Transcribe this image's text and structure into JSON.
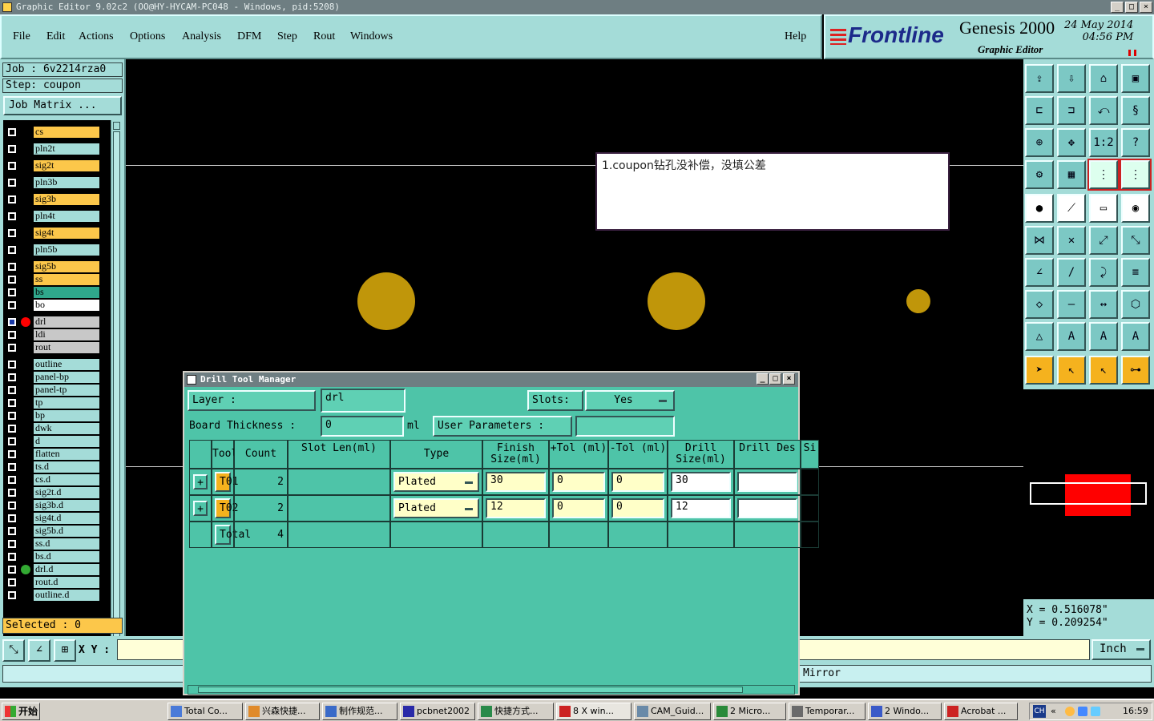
{
  "window": {
    "title": "Graphic Editor 9.02c2 (OO@HY-HYCAM-PC048 - Windows, pid:5208)"
  },
  "menu": [
    "File",
    "Edit",
    "Actions",
    "Options",
    "Analysis",
    "DFM",
    "Step",
    "Rout",
    "Windows"
  ],
  "help_label": "Help",
  "brand": {
    "logo": "Frontline",
    "product": "Genesis 2000",
    "subtitle": "Graphic Editor",
    "date": "24 May 2014",
    "time": "04:56 PM"
  },
  "left_panel": {
    "job": "Job : 6v2214rza0",
    "step": "Step: coupon",
    "job_matrix": "Job Matrix ...",
    "layers": [
      {
        "name": "cs",
        "color": "#fcc74a"
      },
      {
        "name": "pln2t",
        "color": "#a4dcd8"
      },
      {
        "name": "sig2t",
        "color": "#fcc74a"
      },
      {
        "name": "pln3b",
        "color": "#a4dcd8"
      },
      {
        "name": "sig3b",
        "color": "#fcc74a"
      },
      {
        "name": "pln4t",
        "color": "#a4dcd8"
      },
      {
        "name": "sig4t",
        "color": "#fcc74a"
      },
      {
        "name": "pln5b",
        "color": "#a4dcd8"
      },
      {
        "name": "sig5b",
        "color": "#fcc74a"
      },
      {
        "name": "ss",
        "color": "#fcc74a"
      },
      {
        "name": "bs",
        "color": "#2fa88c"
      },
      {
        "name": "bo",
        "color": "#ffffff"
      },
      {
        "name": "drl",
        "color": "#c8c8c8"
      },
      {
        "name": "ldi",
        "color": "#c8c8c8"
      },
      {
        "name": "rout",
        "color": "#c8c8c8"
      },
      {
        "name": "outline",
        "color": "#a4dcd8"
      },
      {
        "name": "panel-bp",
        "color": "#a4dcd8"
      },
      {
        "name": "panel-tp",
        "color": "#a4dcd8"
      },
      {
        "name": "tp",
        "color": "#a4dcd8"
      },
      {
        "name": "bp",
        "color": "#a4dcd8"
      },
      {
        "name": "dwk",
        "color": "#a4dcd8"
      },
      {
        "name": "d",
        "color": "#a4dcd8"
      },
      {
        "name": "flatten",
        "color": "#a4dcd8"
      },
      {
        "name": "ts.d",
        "color": "#a4dcd8"
      },
      {
        "name": "cs.d",
        "color": "#a4dcd8"
      },
      {
        "name": "sig2t.d",
        "color": "#a4dcd8"
      },
      {
        "name": "sig3b.d",
        "color": "#a4dcd8"
      },
      {
        "name": "sig4t.d",
        "color": "#a4dcd8"
      },
      {
        "name": "sig5b.d",
        "color": "#a4dcd8"
      },
      {
        "name": "ss.d",
        "color": "#a4dcd8"
      },
      {
        "name": "bs.d",
        "color": "#a4dcd8"
      },
      {
        "name": "drl.d",
        "color": "#a4dcd8"
      },
      {
        "name": "rout.d",
        "color": "#a4dcd8"
      },
      {
        "name": "outline.d",
        "color": "#a4dcd8"
      }
    ],
    "selected": "Selected : 0"
  },
  "note": "1.coupon钻孔没补偿，没填公差",
  "coords": {
    "x": "X = 0.516078\"",
    "y": "Y = 0.209254\""
  },
  "bottom": {
    "xy_label": "X Y :",
    "unit": "Inch",
    "message": "Mirror"
  },
  "dialog": {
    "title": "Drill Tool Manager",
    "layer_label": "Layer :",
    "layer_value": "drl",
    "slots_label": "Slots:",
    "slots_value": "Yes",
    "thickness_label": "Board Thickness :",
    "thickness_value": "0",
    "thickness_unit": "ml",
    "user_params_label": "User Parameters :",
    "columns": [
      "Tool",
      "Count",
      "Slot Len(ml)",
      "Type",
      "Finish Size(ml)",
      "+Tol (ml)",
      "-Tol (ml)",
      "Drill Size(ml)",
      "Drill Des",
      "Si"
    ],
    "rows": [
      {
        "tool": "T01",
        "count": "2",
        "type": "Plated",
        "finish": "30",
        "ptol": "0",
        "mtol": "0",
        "drill": "30",
        "des": ""
      },
      {
        "tool": "T02",
        "count": "2",
        "type": "Plated",
        "finish": "12",
        "ptol": "0",
        "mtol": "0",
        "drill": "12",
        "des": ""
      }
    ],
    "total_label": "Total",
    "total_count": "4"
  },
  "taskbar": {
    "start": "开始",
    "items": [
      "Total Co...",
      "兴森快捷...",
      "制作规范...",
      "pcbnet2002",
      "快捷方式...",
      "8 X win...",
      "CAM_Guid...",
      "2 Micro...",
      "Temporar...",
      "2 Windo...",
      "Acrobat ..."
    ],
    "tray_lang": "CH",
    "clock": "16:59"
  }
}
